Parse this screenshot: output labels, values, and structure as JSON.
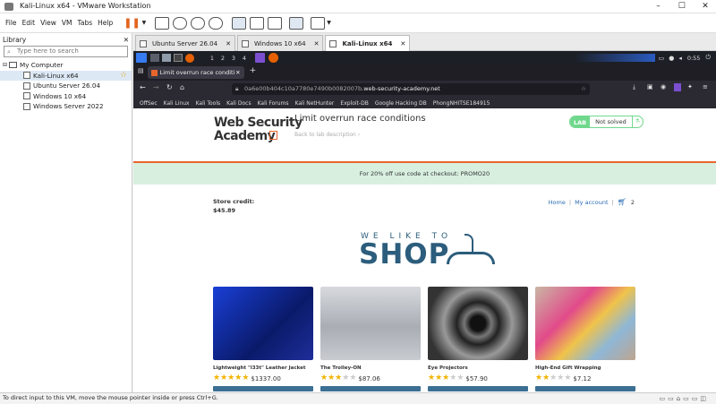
{
  "window": {
    "title": "Kali-Linux x64 - VMware Workstation",
    "controls": [
      "–",
      "☐",
      "✕"
    ]
  },
  "menu": {
    "items": [
      "File",
      "Edit",
      "View",
      "VM",
      "Tabs",
      "Help"
    ]
  },
  "library": {
    "title": "Library",
    "close": "✕",
    "search_placeholder": "Type here to search",
    "tree": [
      {
        "label": "My Computer",
        "level": 0
      },
      {
        "label": "Kali-Linux x64",
        "level": 1
      },
      {
        "label": "Ubuntu Server 26.04",
        "level": 1
      },
      {
        "label": "Windows 10 x64",
        "level": 1
      },
      {
        "label": "Windows Server 2022",
        "level": 1
      }
    ]
  },
  "vm_tabs": [
    {
      "label": "Ubuntu Server 26.04",
      "active": false
    },
    {
      "label": "Windows 10 x64",
      "active": false
    },
    {
      "label": "Kali-Linux x64",
      "active": true
    }
  ],
  "kali_panel": {
    "workspaces": [
      "1",
      "2",
      "3",
      "4"
    ],
    "time": "0:55"
  },
  "browser": {
    "tab_title": "Limit overrun race conditi",
    "url_prefix": "0a6e00b404c10a7780e7490b0082007b",
    "url_domain": ".web-security-academy.net",
    "bookmarks": [
      "OffSec",
      "Kali Linux",
      "Kali Tools",
      "Kali Docs",
      "Kali Forums",
      "Kali NetHunter",
      "Exploit-DB",
      "Google Hacking DB",
      "PhongNHITSE184915"
    ]
  },
  "lab": {
    "logo_line1": "Web Security",
    "logo_line2": "Academy",
    "title": "Limit overrun race conditions",
    "back": "Back to lab description",
    "badge_lab": "LAB",
    "badge_status": "Not solved"
  },
  "promo": "For 20% off use code at checkout: PROMO20",
  "store": {
    "credit_label": "Store credit:",
    "credit_value": "$45.89",
    "home": "Home",
    "account": "My account",
    "cart_count": "2",
    "slogan_top": "WE LIKE TO",
    "slogan_main": "SHOP"
  },
  "products": [
    {
      "name": "Lightweight \"l33t\" Leather Jacket",
      "price": "$1337.00",
      "rating": 5
    },
    {
      "name": "The Trolley-ON",
      "price": "$87.06",
      "rating": 3
    },
    {
      "name": "Eye Projectors",
      "price": "$57.90",
      "rating": 3
    },
    {
      "name": "High-End Gift Wrapping",
      "price": "$7.12",
      "rating": 2
    }
  ],
  "status": {
    "text": "To direct input to this VM, move the mouse pointer inside or press Ctrl+G."
  }
}
